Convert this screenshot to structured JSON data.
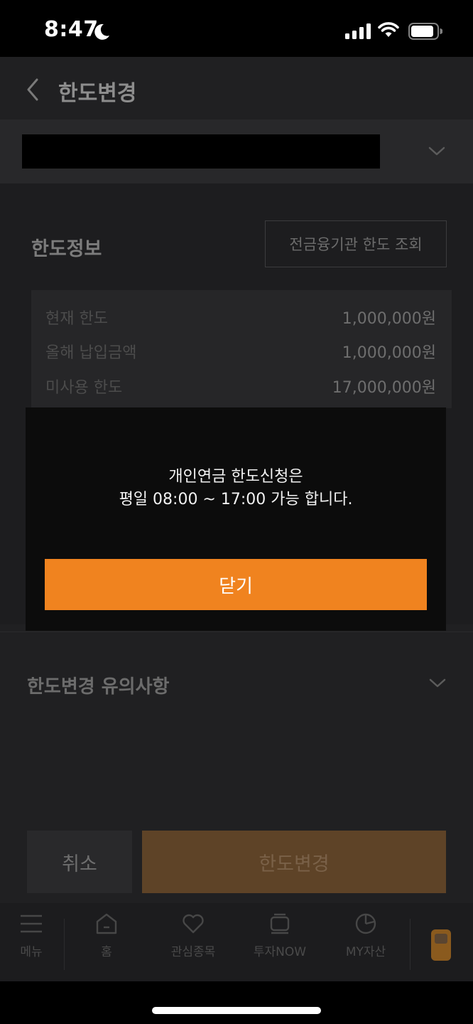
{
  "status_bar": {
    "time": "8:47"
  },
  "header": {
    "title": "한도변경"
  },
  "limit_info": {
    "title": "한도정보",
    "inquiry_button": "전금융기관 한도 조회",
    "rows": [
      {
        "label": "현재 한도",
        "value": "1,000,000원"
      },
      {
        "label": "올해 납입금액",
        "value": "1,000,000원"
      },
      {
        "label": "미사용 한도",
        "value": "17,000,000원"
      }
    ]
  },
  "notice": {
    "title": "한도변경 유의사항"
  },
  "actions": {
    "cancel": "취소",
    "change": "한도변경"
  },
  "bottom_nav": {
    "items": [
      {
        "label": "메뉴",
        "icon": "menu-icon"
      },
      {
        "label": "홈",
        "icon": "home-icon"
      },
      {
        "label": "관심종목",
        "icon": "heart-icon"
      },
      {
        "label": "투자NOW",
        "icon": "investment-now-icon"
      },
      {
        "label": "MY자산",
        "icon": "pie-chart-icon"
      }
    ]
  },
  "modal": {
    "line1": "개인연금 한도신청은",
    "line2": "평일 08:00 ~ 17:00 가능 합니다.",
    "close_label": "닫기"
  },
  "colors": {
    "accent": "#f0831f",
    "disabled_accent": "#5e4327",
    "background": "#202022"
  }
}
